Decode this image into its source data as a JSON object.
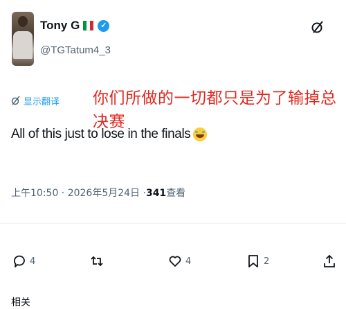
{
  "user": {
    "display_name": "Tony G",
    "handle": "@TGTatum4_3",
    "flag_colors": [
      "#009246",
      "#ffffff",
      "#ce2b37"
    ],
    "verified_glyph": "✓"
  },
  "overlay_caption": "你们所做的一切都只是为了输掉总决赛",
  "translate_label": "显示翻译",
  "tweet_text": "All of this just to lose in the finals",
  "emoji": "rolling-on-floor-laughing",
  "meta": {
    "timestamp": "上午10:50 · 2026年5月24日 · ",
    "views_count": "341",
    "views_label": " 查看"
  },
  "actions": {
    "reply_count": "4",
    "retweet_count": "",
    "like_count": "4",
    "bookmark_count": "2"
  },
  "related_label": "相关"
}
